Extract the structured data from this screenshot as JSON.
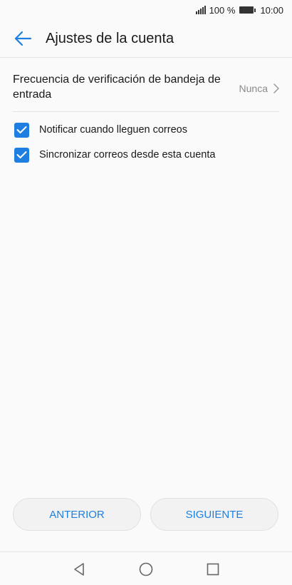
{
  "status_bar": {
    "battery_percent": "100 %",
    "time": "10:00",
    "icons": [
      "signal-icon",
      "battery-icon"
    ]
  },
  "header": {
    "title": "Ajustes de la cuenta",
    "back_icon": "arrow-left-icon"
  },
  "settings": {
    "frequency": {
      "label": "Frecuencia de verificación de bandeja de entrada",
      "value": "Nunca",
      "icon": "chevron-right-icon"
    },
    "checkboxes": [
      {
        "label": "Notificar cuando lleguen correos",
        "checked": true
      },
      {
        "label": "Sincronizar correos desde esta cuenta",
        "checked": true
      }
    ]
  },
  "buttons": {
    "previous": "ANTERIOR",
    "next": "SIGUIENTE"
  },
  "nav_bar": {
    "icons": [
      "back-triangle-icon",
      "home-circle-icon",
      "recents-square-icon"
    ]
  },
  "colors": {
    "accent": "#1e7fe0",
    "background": "#fafafa",
    "secondary_text": "#8a8a8a"
  }
}
